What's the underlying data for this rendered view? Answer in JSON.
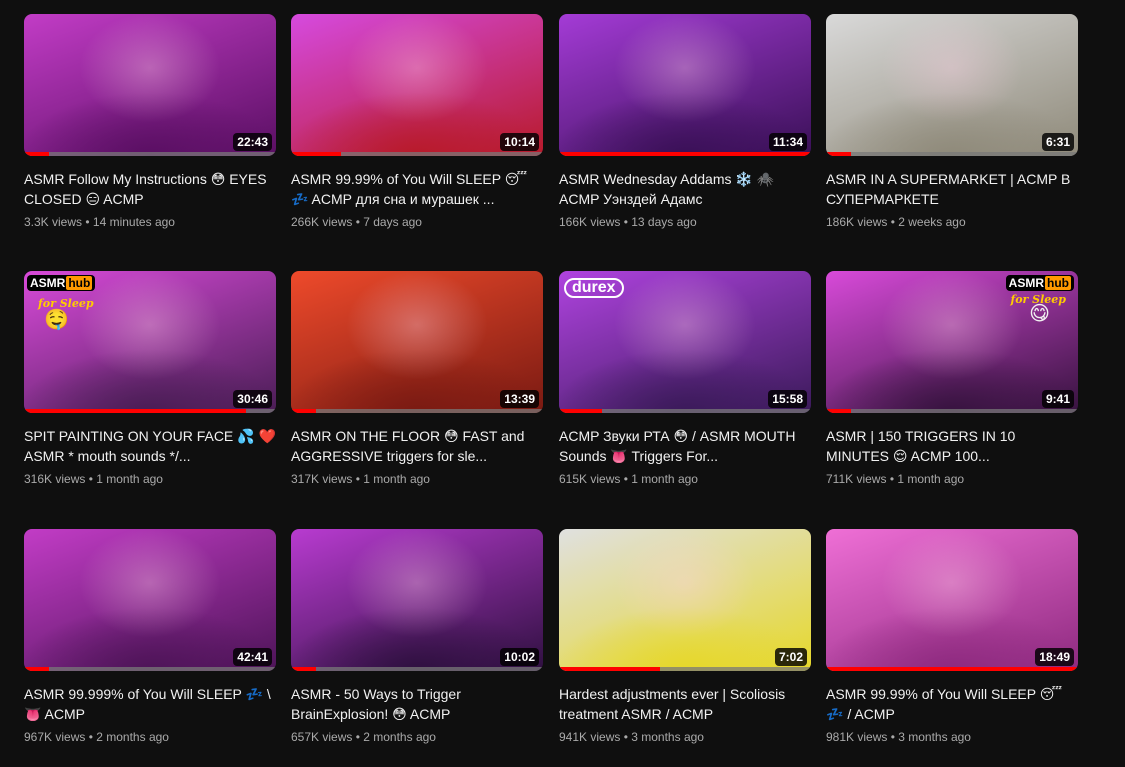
{
  "videos": [
    {
      "title": "ASMR Follow My Instructions 😳 EYES CLOSED 😑 ACMP",
      "views": "3.3K views",
      "age": "14 minutes ago",
      "duration": "22:43",
      "progress": 0.1,
      "colors": [
        "#c23cc6",
        "#5a0f63"
      ]
    },
    {
      "title": "ASMR 99.99% of You Will SLEEP 😴 💤 ACMP для сна и мурашек ...",
      "views": "266K views",
      "age": "7 days ago",
      "duration": "10:14",
      "progress": 0.2,
      "colors": [
        "#d64adf",
        "#b81a2a"
      ]
    },
    {
      "title": "ASMR Wednesday Addams ❄️ 🕷️ ACMP Уэнздей Адамс",
      "views": "166K views",
      "age": "13 days ago",
      "duration": "11:34",
      "progress": 1.0,
      "colors": [
        "#a43bd6",
        "#3a1057"
      ]
    },
    {
      "title": "ASMR IN A SUPERMARKET | ACMP В СУПЕРМАРКЕТЕ",
      "views": "186K views",
      "age": "2 weeks ago",
      "duration": "6:31",
      "progress": 0.1,
      "colors": [
        "#d9d9d9",
        "#8f8a7a"
      ]
    },
    {
      "title": "SPIT PAINTING ON YOUR FACE 💦 ❤️ ASMR * mouth sounds */...",
      "views": "316K views",
      "age": "1 month ago",
      "duration": "30:46",
      "progress": 0.88,
      "colors": [
        "#d84ad9",
        "#4a1d55"
      ],
      "badge_hub": [
        "ASMR",
        "hub"
      ],
      "badge_sleep": "for Sleep",
      "badge_emoji": "🤤"
    },
    {
      "title": "ASMR ON THE FLOOR 😳 FAST and AGGRESSIVE triggers for sle...",
      "views": "317K views",
      "age": "1 month ago",
      "duration": "13:39",
      "progress": 0.1,
      "colors": [
        "#ee4a2b",
        "#7a1a12"
      ]
    },
    {
      "title": "ACMP Звуки РТА 😳 / ASMR MOUTH Sounds 👅 Triggers For...",
      "views": "615K views",
      "age": "1 month ago",
      "duration": "15:58",
      "progress": 0.17,
      "colors": [
        "#b043e0",
        "#3b1a5a"
      ],
      "badge_durex": "durex"
    },
    {
      "title": "ASMR | 150 TRIGGERS IN 10 MINUTES 😌 ACMP 100...",
      "views": "711K views",
      "age": "1 month ago",
      "duration": "9:41",
      "progress": 0.1,
      "colors": [
        "#d84ad9",
        "#37133f"
      ],
      "badge_hub": [
        "ASMR",
        "hub"
      ],
      "badge_sleep": "for Sleep",
      "badge_emoji": "😋"
    },
    {
      "title": "ASMR 99.999% of You Will SLEEP 💤 \\ 👅 ACMP",
      "views": "967K views",
      "age": "2 months ago",
      "duration": "42:41",
      "progress": 0.1,
      "colors": [
        "#c23cc6",
        "#4e1458"
      ]
    },
    {
      "title": "ASMR - 50 Ways to Trigger BrainExplosion! 😳 ACMP",
      "views": "657K views",
      "age": "2 months ago",
      "duration": "10:02",
      "progress": 0.1,
      "colors": [
        "#b83bd0",
        "#2f1040"
      ]
    },
    {
      "title": "Hardest adjustments ever | Scoliosis treatment ASMR / ACMP",
      "views": "941K views",
      "age": "3 months ago",
      "duration": "7:02",
      "progress": 0.4,
      "colors": [
        "#e0e0e0",
        "#e6d82a"
      ]
    },
    {
      "title": "ASMR 99.99% of You Will SLEEP 😴 💤 / ACMP",
      "views": "981K views",
      "age": "3 months ago",
      "duration": "18:49",
      "progress": 1.0,
      "colors": [
        "#ef6fd6",
        "#8e2a7f"
      ]
    }
  ]
}
